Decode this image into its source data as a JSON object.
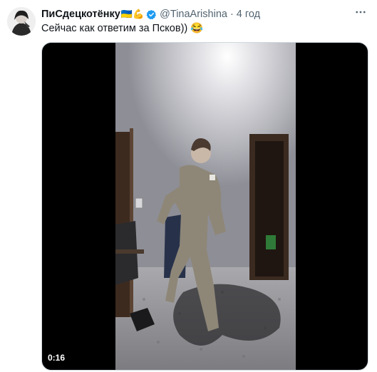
{
  "tweet": {
    "display_name": "ПиСдецкотёнку",
    "name_emoji": "🇺🇦💪",
    "handle": "@TinaArishina",
    "separator": "·",
    "time": "4 год",
    "text": "Сейчас как ответим за Псков)) 😂"
  },
  "media": {
    "duration": "0:16"
  },
  "icons": {
    "verified": "verified-badge-icon",
    "more": "more-horizontal-icon"
  },
  "colors": {
    "verified": "#1d9bf0",
    "secondary_text": "#536471"
  }
}
